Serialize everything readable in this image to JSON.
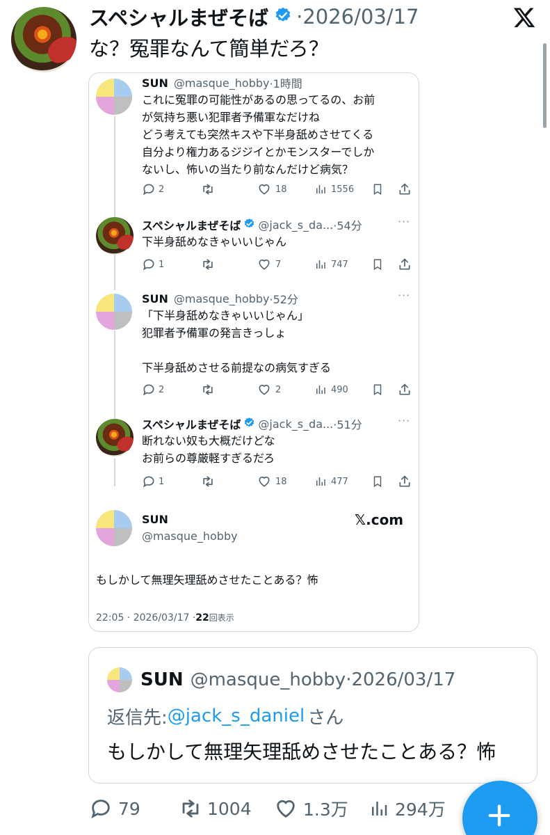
{
  "main": {
    "author_name": "スペシャルまぜそば",
    "date": "·2026/03/17",
    "text": "な？冤罪なんて簡単だろ？"
  },
  "card": {
    "tweets": [
      {
        "name": "SUN",
        "handle": "@masque_hobby",
        "time": "·1時間",
        "lines": [
          "これに冤罪の可能性があるの思ってるの、お前",
          "が気持ち悪い犯罪者予備軍なだけね",
          "どう考えても突然キスや下半身舐めさせてくる",
          "自分より権力あるジジイとかモンスターでしか",
          "ないし、怖いの当たり前なんだけど病気？"
        ],
        "replies": "2",
        "retweets": "",
        "likes": "18",
        "views": "1556"
      },
      {
        "name": "スペシャルまぜそば",
        "handle": "@jack_s_da...",
        "time": "·54分",
        "lines": [
          "下半身舐めなきゃいいじゃん"
        ],
        "replies": "1",
        "retweets": "",
        "likes": "7",
        "views": "747"
      },
      {
        "name": "SUN",
        "handle": "@masque_hobby",
        "time": "·52分",
        "lines": [
          "「下半身舐めなきゃいいじゃん」",
          "犯罪者予備軍の発言きっしょ",
          "",
          "下半身舐めさせる前提なの病気すぎる"
        ],
        "replies": "2",
        "retweets": "",
        "likes": "2",
        "views": "490"
      },
      {
        "name": "スペシャルまぜそば",
        "handle": "@jack_s_da...",
        "time": "·51分",
        "lines": [
          "断れない奴も大概だけどな",
          "お前らの尊厳軽すぎるだろ"
        ],
        "replies": "1",
        "retweets": "",
        "likes": "18",
        "views": "477"
      }
    ],
    "final": {
      "name": "SUN",
      "handle": "@masque_hobby",
      "site": "𝕏.com",
      "text": "もしかして無理矢理舐めさせたことある？怖",
      "timestamp": "22:05 · 2026/03/17 · ",
      "view_count": "22",
      "view_label": "回表示"
    }
  },
  "quote": {
    "name": "SUN",
    "handle": "@masque_hobby",
    "date": "·2026/03/17",
    "reply_prefix": "返信先: ",
    "reply_handle": "@jack_s_daniel",
    "reply_suffix": "さん",
    "text": "もしかして無理矢理舐めさせたことある？怖"
  },
  "bottom_actions": {
    "replies": "79",
    "retweets": "1004",
    "likes": "1.3万",
    "views": "294万"
  },
  "icons": {
    "logo": "x-logo-icon",
    "verified": "verified-badge-icon",
    "compose": "plus-icon"
  },
  "colors": {
    "accent": "#1d9bf0",
    "muted": "#536471",
    "border": "#cfd9de"
  }
}
